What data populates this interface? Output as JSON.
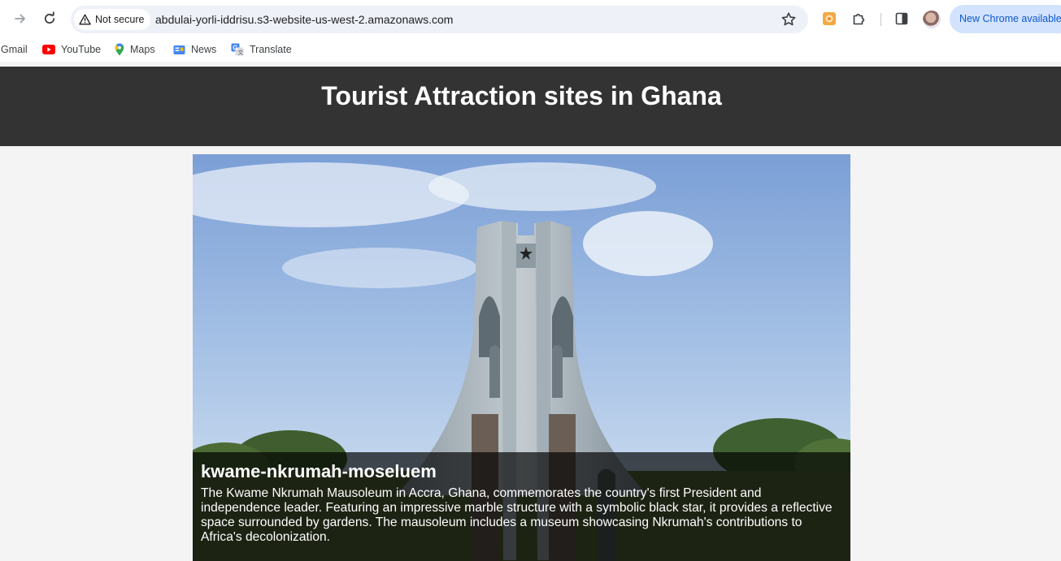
{
  "browser": {
    "security_label": "Not secure",
    "url": "abdulai-yorli-iddrisu.s3-website-us-west-2.amazonaws.com",
    "update_label": "New Chrome available",
    "bookmarks": [
      {
        "label": "Gmail",
        "icon": "gmail-icon"
      },
      {
        "label": "YouTube",
        "icon": "youtube-icon"
      },
      {
        "label": "Maps",
        "icon": "maps-icon"
      },
      {
        "label": "News",
        "icon": "news-icon"
      },
      {
        "label": "Translate",
        "icon": "translate-icon"
      }
    ]
  },
  "page": {
    "title": "Tourist Attraction sites in Ghana",
    "attraction": {
      "name": "kwame-nkrumah-moseluem",
      "description": "The Kwame Nkrumah Mausoleum in Accra, Ghana, commemorates the country's first President and independence leader. Featuring an impressive marble structure with a symbolic black star, it provides a reflective space surrounded by gardens. The mausoleum includes a museum showcasing Nkrumah's contributions to Africa's decolonization."
    }
  },
  "colors": {
    "header_bg": "#333333",
    "page_bg": "#f4f4f4",
    "caption_bg": "rgba(0,0,0,0.68)",
    "update_chip_bg": "#d3e3fd"
  }
}
